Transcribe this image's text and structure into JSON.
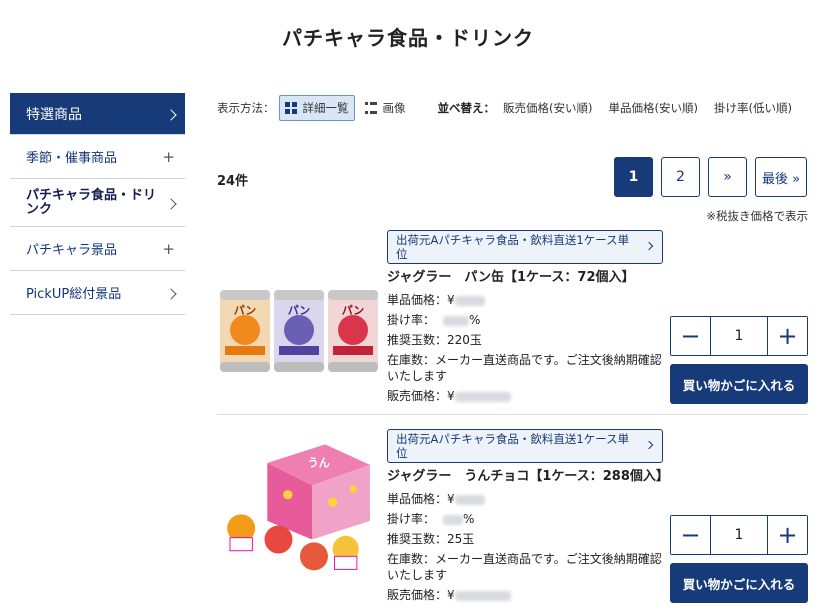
{
  "page_title": "パチキャラ食品・ドリンク",
  "sidebar": {
    "items": [
      {
        "label": "特選商品",
        "symbol": "chevron"
      },
      {
        "label": "季節・催事商品",
        "symbol": "plus"
      },
      {
        "label": "パチキャラ食品・ドリンク",
        "symbol": "chevron"
      },
      {
        "label": "パチキャラ景品",
        "symbol": "plus"
      },
      {
        "label": "PickUP総付景品",
        "symbol": "chevron"
      }
    ]
  },
  "toolbar": {
    "display_label": "表示方法：",
    "view_detail": "詳細一覧",
    "view_image": "画像",
    "sort_label": "並べ替え：",
    "sort_options": [
      "販売価格(安い順)",
      "単品価格(安い順)",
      "掛け率(低い順)"
    ]
  },
  "result_count": "24件",
  "pagination": {
    "pages": [
      "1",
      "2"
    ],
    "next": "»",
    "last": "最後 »"
  },
  "tax_note": "※税抜き価格で表示",
  "products": [
    {
      "shipping": "出荷元Aパチキャラ食品・飲料直送1ケース単位",
      "name": "ジャグラー　パン缶【1ケース：72個入】",
      "unit_price_label": "単品価格：¥",
      "rate_label": "掛け率：",
      "rate_suffix": "%",
      "points": "推奨玉数：220玉",
      "stock": "在庫数：メーカー直送商品です。ご注文後納期確認いたします",
      "sale_price_label": "販売価格：¥",
      "quantity": "1",
      "cart_label": "買い物かごに入れる",
      "minus": "−",
      "plus": "+"
    },
    {
      "shipping": "出荷元Aパチキャラ食品・飲料直送1ケース単位",
      "name": "ジャグラー　うんチョコ【1ケース：288個入】",
      "unit_price_label": "単品価格：¥",
      "rate_label": "掛け率：",
      "rate_suffix": "%",
      "points": "推奨玉数：25玉",
      "stock": "在庫数：メーカー直送商品です。ご注文後納期確認いたします",
      "sale_price_label": "販売価格：¥",
      "quantity": "1",
      "cart_label": "買い物かごに入れる",
      "minus": "−",
      "plus": "+"
    }
  ]
}
